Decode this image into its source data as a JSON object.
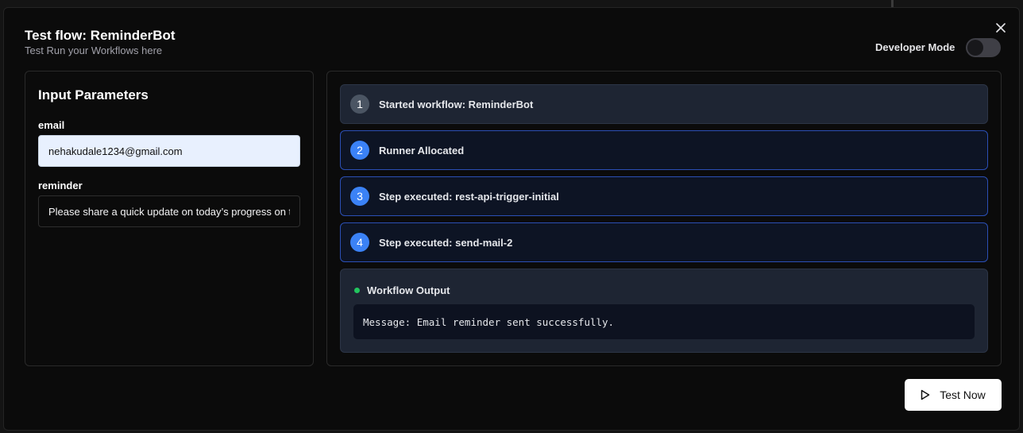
{
  "dialog": {
    "title": "Test flow: ReminderBot",
    "subtitle": "Test Run your Workflows here",
    "close_icon": "close-icon",
    "developer_mode": {
      "label": "Developer Mode",
      "enabled": false
    }
  },
  "input_panel": {
    "title": "Input Parameters",
    "fields": [
      {
        "label": "email",
        "value": "nehakudale1234@gmail.com"
      },
      {
        "label": "reminder",
        "value": "Please share a quick update on today’s progress on the project"
      }
    ]
  },
  "run_log": {
    "steps": [
      {
        "number": "1",
        "text": "Started workflow: ReminderBot"
      },
      {
        "number": "2",
        "text": "Runner Allocated"
      },
      {
        "number": "3",
        "text": "Step executed: rest-api-trigger-initial"
      },
      {
        "number": "4",
        "text": "Step executed: send-mail-2"
      }
    ],
    "output": {
      "title": "Workflow Output",
      "status_color": "#22c55e",
      "message": "Message: Email reminder sent successfully."
    }
  },
  "footer": {
    "test_button_label": "Test Now",
    "test_button_icon": "play-icon"
  },
  "colors": {
    "accent_blue": "#3b82f6",
    "success_green": "#22c55e"
  }
}
